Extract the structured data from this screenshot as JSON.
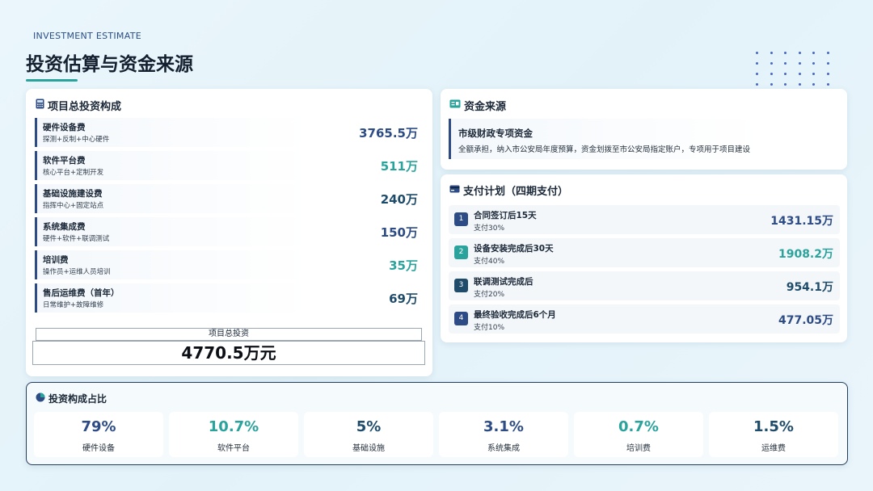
{
  "header": {
    "subtitle_en": "INVESTMENT ESTIMATE",
    "title": "投资估算与资金来源"
  },
  "investment": {
    "title": "项目总投资构成",
    "icon": "calculator-icon",
    "items": [
      {
        "name": "硬件设备费",
        "desc": "探测+反制+中心硬件",
        "amount": "3765.5万",
        "color": "#2d4c86"
      },
      {
        "name": "软件平台费",
        "desc": "核心平台+定制开发",
        "amount": "511万",
        "color": "#2aa39c"
      },
      {
        "name": "基础设施建设费",
        "desc": "指挥中心+固定站点",
        "amount": "240万",
        "color": "#1f4c6a"
      },
      {
        "name": "系统集成费",
        "desc": "硬件+软件+联调测试",
        "amount": "150万",
        "color": "#2d4c86"
      },
      {
        "name": "培训费",
        "desc": "操作员+运维人员培训",
        "amount": "35万",
        "color": "#2aa39c"
      },
      {
        "name": "售后运维费（首年）",
        "desc": "日常维护+故障维修",
        "amount": "69万",
        "color": "#1f4c6a"
      }
    ],
    "total_label": "项目总投资",
    "total_value": "4770.5万元"
  },
  "funding": {
    "title": "资金来源",
    "icon": "money-icon",
    "heading": "市级财政专项资金",
    "text": "全额承担，纳入市公安局年度预算，资金划拨至市公安局指定账户，专项用于项目建设"
  },
  "payment": {
    "title": "支付计划（四期支付）",
    "icon": "credit-card-icon",
    "items": [
      {
        "num": "1",
        "name": "合同签订后15天",
        "desc": "支付30%",
        "amount": "1431.15万",
        "color": "#2d4c86"
      },
      {
        "num": "2",
        "name": "设备安装完成后30天",
        "desc": "支付40%",
        "amount": "1908.2万",
        "color": "#2aa39c"
      },
      {
        "num": "3",
        "name": "联调测试完成后",
        "desc": "支付20%",
        "amount": "954.1万",
        "color": "#1f4c6a"
      },
      {
        "num": "4",
        "name": "最终验收完成后6个月",
        "desc": "支付10%",
        "amount": "477.05万",
        "color": "#2d4c86"
      }
    ]
  },
  "ratio": {
    "title": "投资构成占比",
    "icon": "pie-chart-icon",
    "items": [
      {
        "pct": "79%",
        "label": "硬件设备",
        "color": "#2d4c86"
      },
      {
        "pct": "10.7%",
        "label": "软件平台",
        "color": "#2aa39c"
      },
      {
        "pct": "5%",
        "label": "基础设施",
        "color": "#1f4c6a"
      },
      {
        "pct": "3.1%",
        "label": "系统集成",
        "color": "#2d4c86"
      },
      {
        "pct": "0.7%",
        "label": "培训费",
        "color": "#2aa39c"
      },
      {
        "pct": "1.5%",
        "label": "运维费",
        "color": "#1f4c6a"
      }
    ]
  },
  "colors": {
    "navy": "#2d4c86",
    "teal": "#2aa39c",
    "dark_teal": "#1f4c6a"
  }
}
